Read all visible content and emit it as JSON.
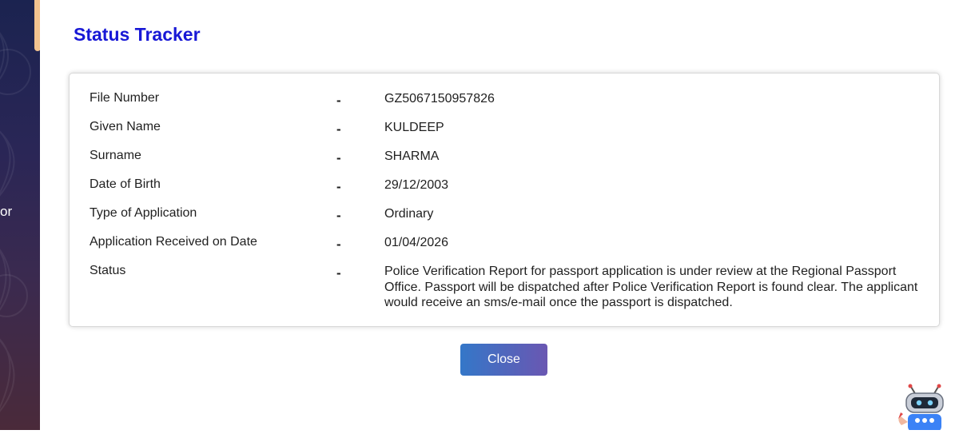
{
  "background": {
    "side_text": "or"
  },
  "modal": {
    "title": "Status Tracker",
    "rows": [
      {
        "label": "File Number",
        "separator": "-",
        "value": "GZ5067150957826"
      },
      {
        "label": "Given Name",
        "separator": "-",
        "value": "KULDEEP"
      },
      {
        "label": "Surname",
        "separator": "-",
        "value": "SHARMA"
      },
      {
        "label": "Date of Birth",
        "separator": "-",
        "value": "29/12/2003"
      },
      {
        "label": "Type of Application",
        "separator": "-",
        "value": "Ordinary"
      },
      {
        "label": "Application Received on Date",
        "separator": "-",
        "value": "01/04/2026"
      },
      {
        "label": "Status",
        "separator": "-",
        "value": "Police Verification Report for passport application is under review at the Regional Passport Office. Passport will be dispatched after Police Verification Report is found clear. The applicant would receive an sms/e-mail once the passport is dispatched."
      }
    ],
    "close_label": "Close"
  },
  "colors": {
    "title": "#1818d6",
    "button_start": "#3477c8",
    "button_end": "#6a57b2"
  },
  "icons": {
    "chatbot": "robot-icon"
  }
}
